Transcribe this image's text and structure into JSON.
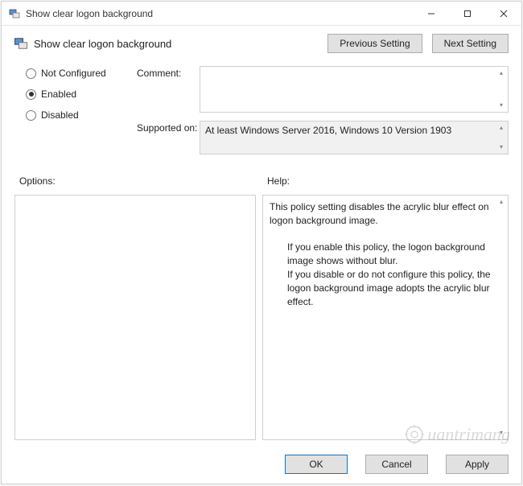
{
  "window": {
    "title": "Show clear logon background"
  },
  "header": {
    "heading": "Show clear logon background"
  },
  "buttons": {
    "prev": "Previous Setting",
    "next": "Next Setting",
    "ok": "OK",
    "cancel": "Cancel",
    "apply": "Apply"
  },
  "radios": {
    "not_configured": "Not Configured",
    "enabled": "Enabled",
    "disabled": "Disabled",
    "selected": "enabled"
  },
  "fields": {
    "comment_label": "Comment:",
    "comment_value": "",
    "supported_label": "Supported on:",
    "supported_value": "At least Windows Server 2016, Windows 10 Version 1903"
  },
  "panels": {
    "options_label": "Options:",
    "help_label": "Help:",
    "help_text": {
      "p1": "This policy setting disables the acrylic blur effect on logon background image.",
      "p2": "If you enable this policy, the logon background image shows without blur.",
      "p3": "If you disable or do not configure this policy, the logon background image adopts the acrylic blur effect."
    }
  },
  "watermark": "uantrimang"
}
